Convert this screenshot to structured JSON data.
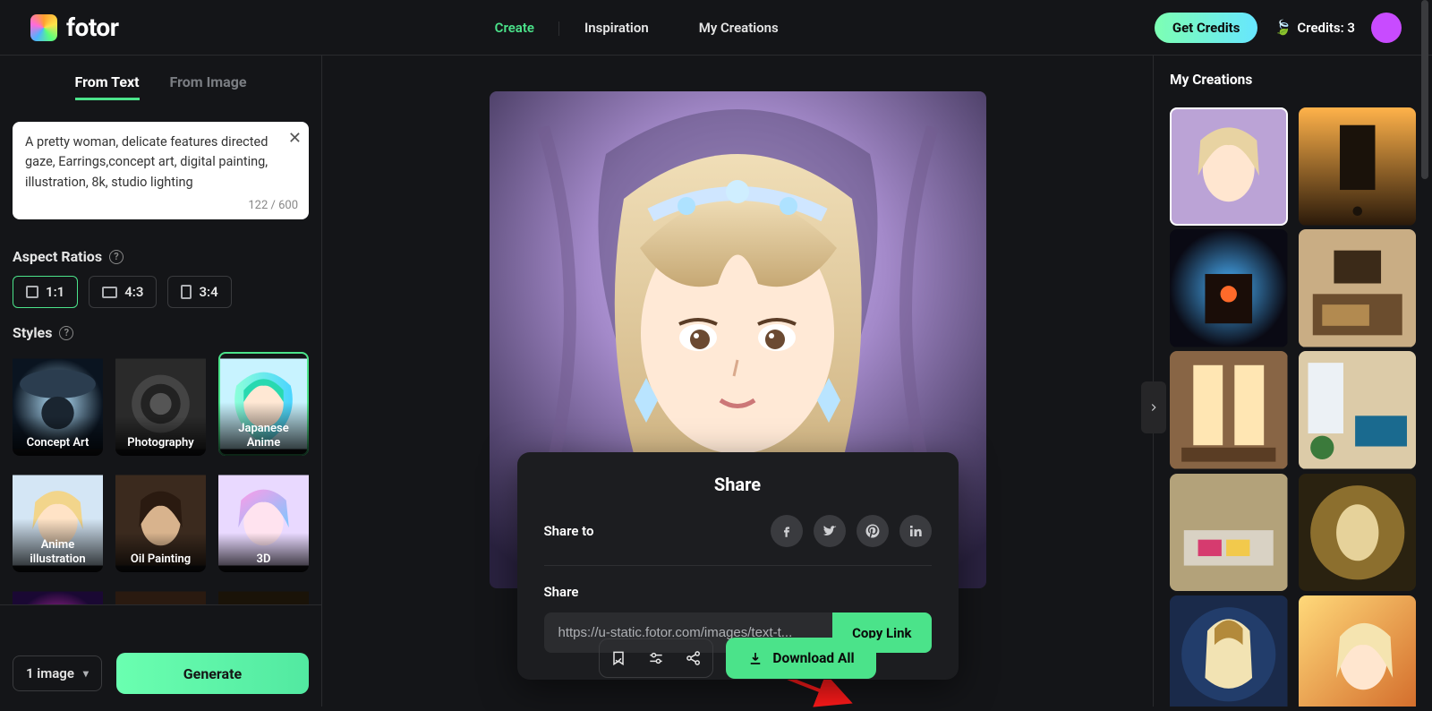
{
  "header": {
    "logo_text": "fotor",
    "nav": {
      "create": "Create",
      "inspiration": "Inspiration",
      "my_creations": "My Creations"
    },
    "get_credits": "Get Credits",
    "credits_label": "Credits: 3"
  },
  "sidebar_left": {
    "tabs": {
      "from_text": "From Text",
      "from_image": "From Image"
    },
    "prompt": "A pretty woman, delicate features directed gaze, Earrings,concept art, digital painting, illustration, 8k, studio lighting",
    "prompt_count": "122 / 600",
    "aspect_title": "Aspect Ratios",
    "ratios": {
      "r1": "1:1",
      "r2": "4:3",
      "r3": "3:4"
    },
    "styles_title": "Styles",
    "styles": [
      "Concept Art",
      "Photography",
      "Japanese Anime",
      "Anime illustration",
      "Oil Painting",
      "3D"
    ],
    "image_count": "1 image",
    "generate": "Generate"
  },
  "share": {
    "title": "Share",
    "share_to": "Share to",
    "share_label": "Share",
    "link": "https://u-static.fotor.com/images/text-t...",
    "copy": "Copy Link"
  },
  "actions": {
    "download_all": "Download All"
  },
  "sidebar_right": {
    "title": "My Creations"
  }
}
